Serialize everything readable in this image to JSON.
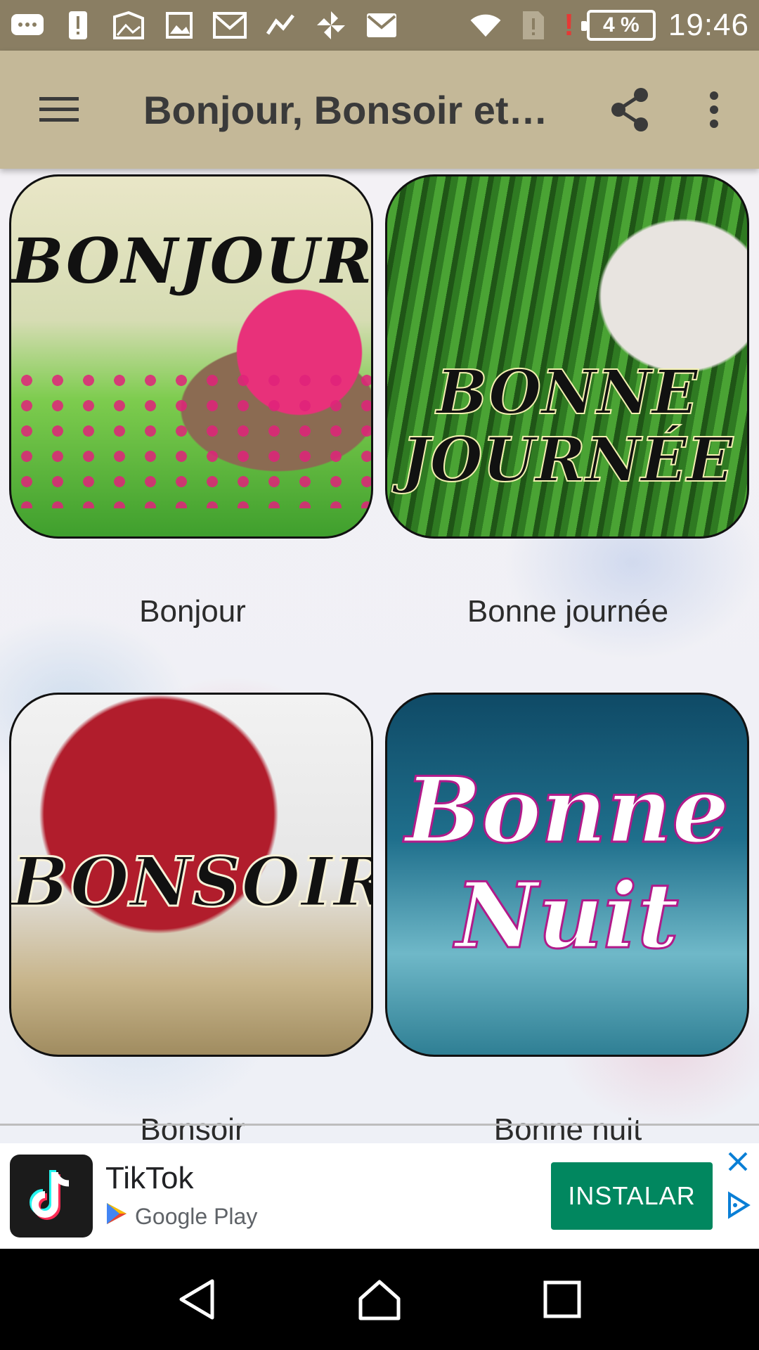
{
  "status_bar": {
    "time": "19:46",
    "battery": "4 %",
    "icons": [
      "message-icon",
      "alert-icon",
      "gallery-icon",
      "image-icon",
      "gmail-icon",
      "trend-icon",
      "pinwheel-icon",
      "mail-icon",
      "wifi-icon",
      "sim-alert-icon",
      "low-battery-alert-icon",
      "battery-icon"
    ]
  },
  "toolbar": {
    "title": "Bonjour, Bonsoir et…",
    "menu_icon": "hamburger-icon",
    "share_icon": "share-icon",
    "more_icon": "more-vert-icon"
  },
  "grid": {
    "items": [
      {
        "label": "Bonjour",
        "image_text": "BONJOUR"
      },
      {
        "label": "Bonne journée",
        "image_text": "BONNE JOURNÉE"
      },
      {
        "label": "Bonsoir",
        "image_text": "BONSOIR"
      },
      {
        "label": "Bonne nuit",
        "image_text": "Bonne Nuit"
      }
    ]
  },
  "ad": {
    "app_name": "TikTok",
    "store": "Google Play",
    "install_label": "INSTALAR",
    "accent_color": "#01875f"
  },
  "nav": {
    "back_icon": "back-icon",
    "home_icon": "home-icon",
    "recents_icon": "recents-icon"
  }
}
